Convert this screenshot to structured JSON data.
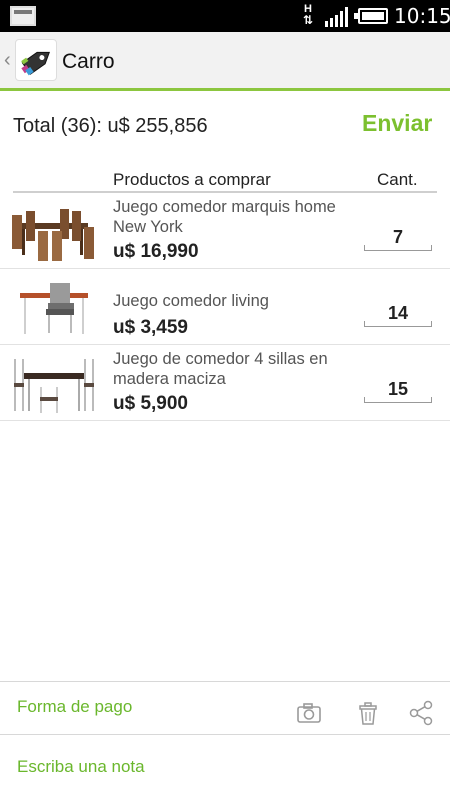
{
  "status_bar": {
    "network_label": "H",
    "time": "10:15"
  },
  "action_bar": {
    "back_icon": "chevron-left-icon",
    "app_icon": "price-tag-icon",
    "title": "Carro"
  },
  "summary": {
    "total_text": "Total (36): u$ 255,856",
    "send_label": "Enviar"
  },
  "table": {
    "headers": {
      "products": "Productos a comprar",
      "quantity": "Cant."
    },
    "rows": [
      {
        "name": "Juego comedor marquis home New York",
        "price": "u$ 16,990",
        "quantity": "7",
        "thumbnail_icon": "dining-set-image"
      },
      {
        "name": "Juego comedor living",
        "price": "u$ 3,459",
        "quantity": "14",
        "thumbnail_icon": "dining-set-image"
      },
      {
        "name": "Juego de comedor 4 sillas en madera maciza",
        "price": "u$ 5,900",
        "quantity": "15",
        "thumbnail_icon": "dining-set-image"
      }
    ]
  },
  "footer": {
    "payment_label": "Forma de pago",
    "note_label": "Escriba una nota",
    "icons": [
      "camera-icon",
      "trash-icon",
      "share-icon"
    ]
  },
  "colors": {
    "accent": "#7cc02f",
    "link": "#6ab72c",
    "actionbar_bg": "#f2f2f2",
    "statusbar_bg": "#000000"
  }
}
